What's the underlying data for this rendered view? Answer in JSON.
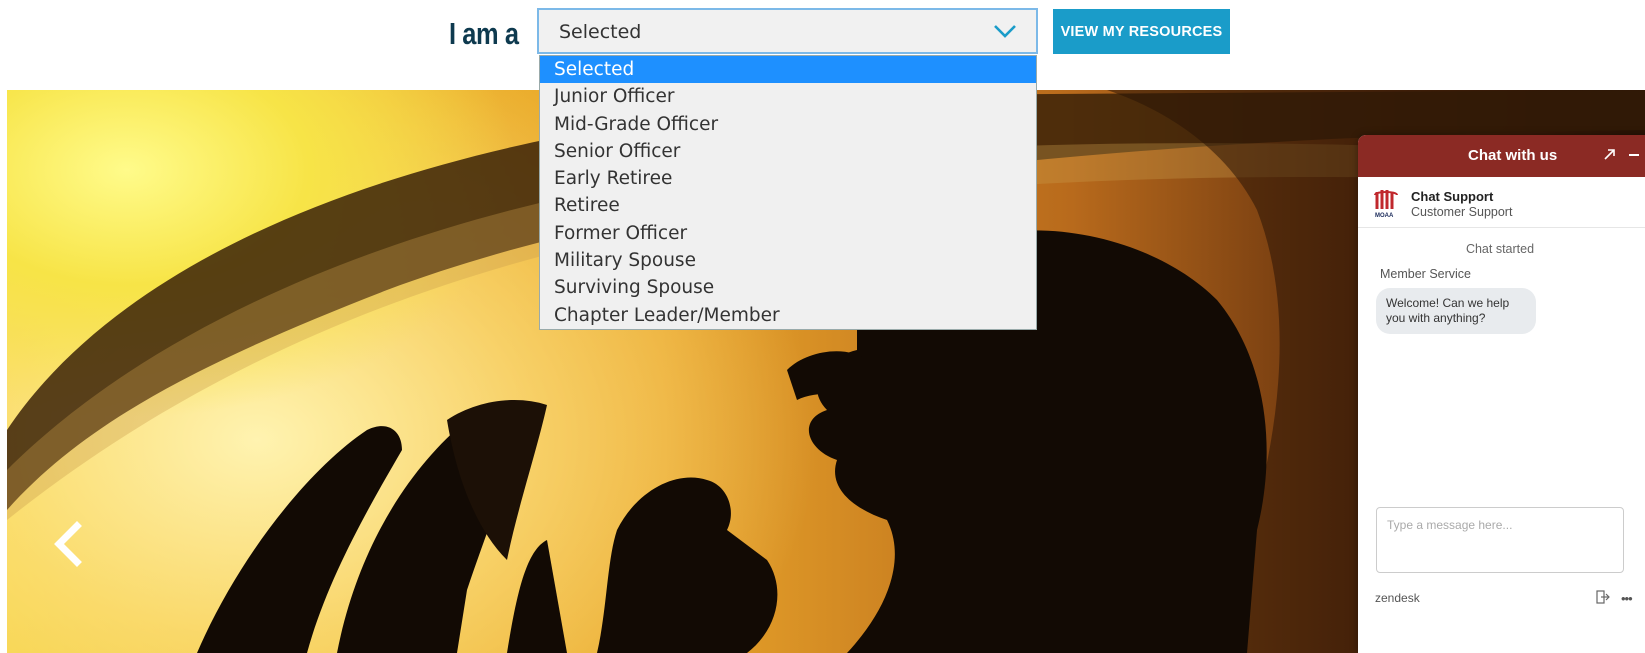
{
  "selector": {
    "label": "I am a",
    "current_value": "Selected",
    "view_button_label": "VIEW MY RESOURCES",
    "options": [
      {
        "label": "Selected",
        "highlighted": true
      },
      {
        "label": "Junior Officer",
        "highlighted": false
      },
      {
        "label": "Mid-Grade Officer",
        "highlighted": false
      },
      {
        "label": "Senior Officer",
        "highlighted": false
      },
      {
        "label": "Early Retiree",
        "highlighted": false
      },
      {
        "label": "Retiree",
        "highlighted": false
      },
      {
        "label": "Former Officer",
        "highlighted": false
      },
      {
        "label": "Military Spouse",
        "highlighted": false
      },
      {
        "label": "Surviving Spouse",
        "highlighted": false
      },
      {
        "label": "Chapter Leader/Member",
        "highlighted": false
      }
    ]
  },
  "hero": {
    "prev_icon": "chevron-left-icon"
  },
  "chat": {
    "title": "Chat with us",
    "popout_icon": "arrow-up-right-icon",
    "minimize_icon": "minus-icon",
    "agent_name": "Chat Support",
    "agent_role": "Customer Support",
    "status": "Chat started",
    "sender": "Member Service",
    "message": "Welcome! Can we help you with anything?",
    "input_placeholder": "Type a message here...",
    "brand": "zendesk",
    "end_chat_icon": "exit-icon",
    "more_icon": "more-dots-icon"
  },
  "colors": {
    "accent": "#1a9cc9",
    "label": "#0e3a4f",
    "chat_header": "#8b2a24",
    "dropdown_highlight": "#1e90ff"
  }
}
